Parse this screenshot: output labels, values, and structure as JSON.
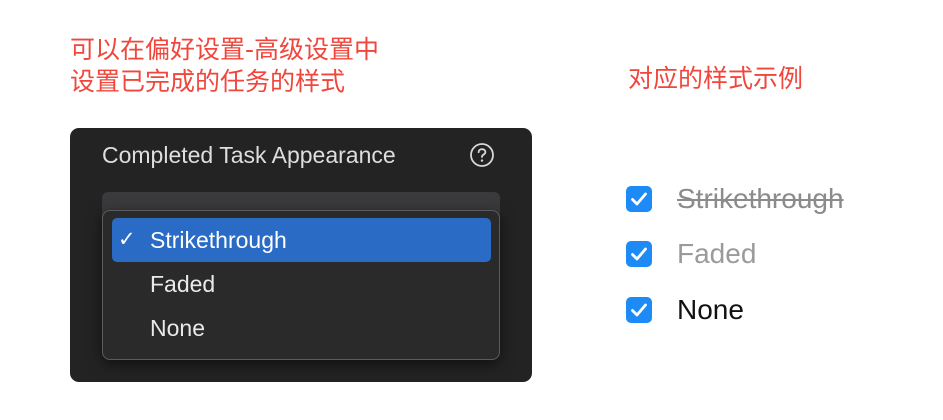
{
  "annotations": {
    "left_line1": "可以在偏好设置-高级设置中",
    "left_line2": "设置已完成的任务的样式",
    "right": "对应的样式示例"
  },
  "panel": {
    "title": "Completed Task Appearance",
    "help_icon": "question-circle-icon",
    "menu": {
      "items": [
        {
          "label": "Strikethrough",
          "selected": true,
          "check": "✓"
        },
        {
          "label": "Faded",
          "selected": false,
          "check": ""
        },
        {
          "label": "None",
          "selected": false,
          "check": ""
        }
      ]
    }
  },
  "examples": [
    {
      "label": "Strikethrough",
      "checked": true
    },
    {
      "label": "Faded",
      "checked": true
    },
    {
      "label": "None",
      "checked": true
    }
  ],
  "colors": {
    "annotation": "#f0463c",
    "panel_bg": "#232323",
    "menu_selected": "#2a6bc6",
    "checkbox": "#1e8af5"
  }
}
